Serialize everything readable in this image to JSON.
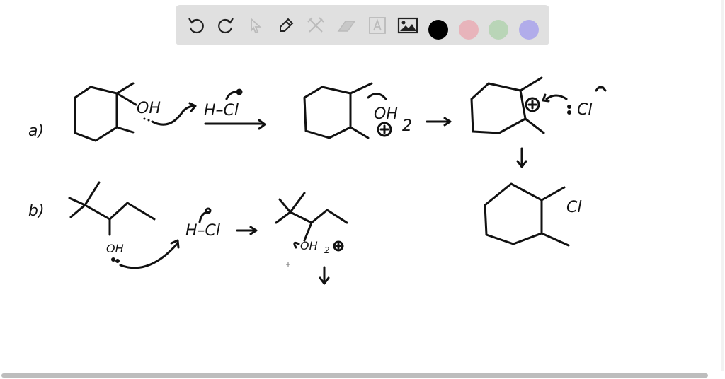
{
  "toolbar": {
    "tools": [
      "undo-icon",
      "redo-icon",
      "select-icon",
      "pen-icon",
      "tools-icon",
      "eraser-icon",
      "text-icon",
      "image-icon"
    ],
    "colors": [
      "#000000",
      "#e8b4bb",
      "#b9d5b7",
      "#b1acea"
    ],
    "selected_color": "#000000"
  },
  "board": {
    "label_a": "a)",
    "label_b": "b)",
    "a_oh": "OH",
    "a_hcl": "H–Cl",
    "a_oh2": "OH",
    "a_oh2_sub": "2",
    "a_cl_ion": "Cl",
    "a_product_cl": "Cl",
    "b_oh": "OH",
    "b_hcl": "H–Cl",
    "b_oh2": "OH",
    "b_oh2_sub": "2"
  }
}
